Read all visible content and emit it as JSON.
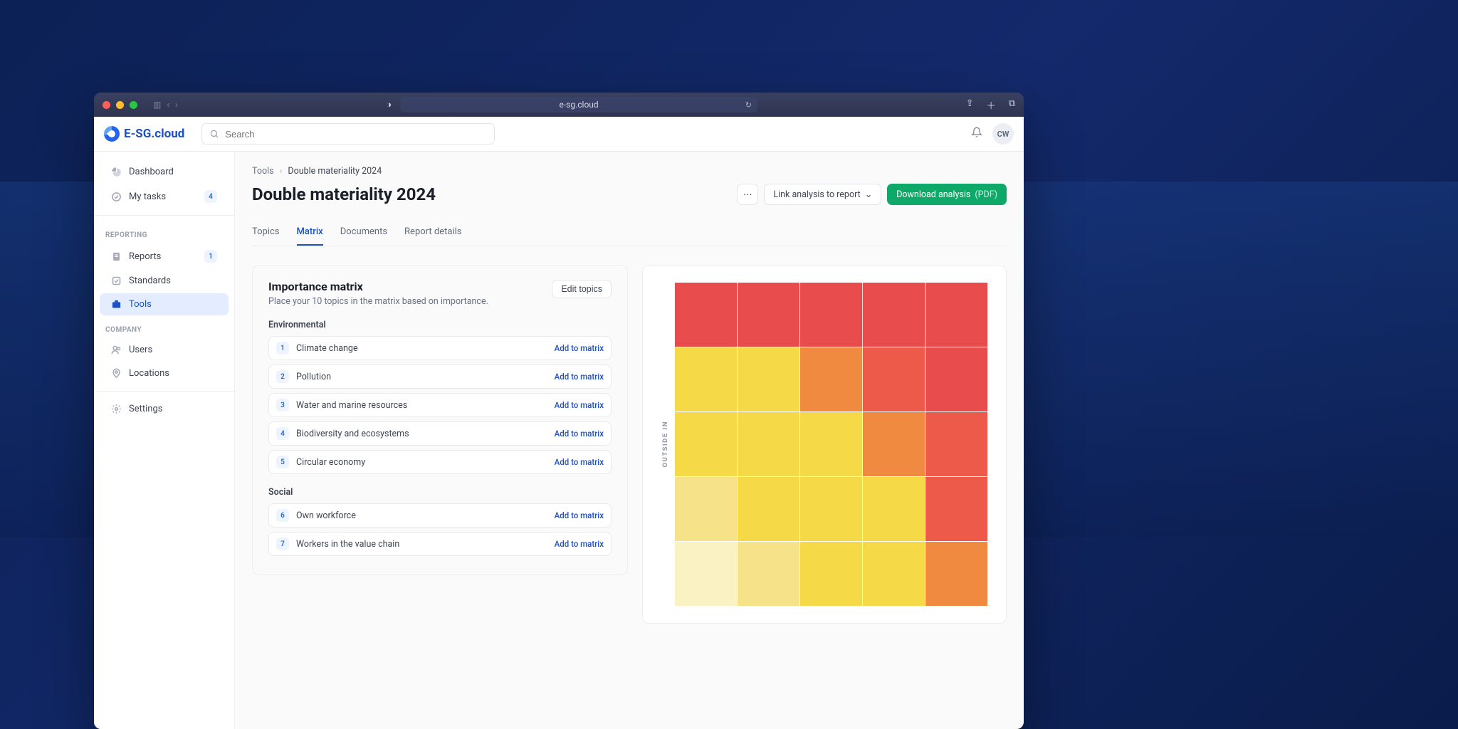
{
  "browser": {
    "url": "e-sg.cloud"
  },
  "app": {
    "logo_text": "E-SG.cloud",
    "search_placeholder": "Search",
    "avatar_initials": "CW"
  },
  "sidebar": {
    "items": [
      {
        "icon": "dashboard-icon",
        "label": "Dashboard"
      },
      {
        "icon": "check-icon",
        "label": "My tasks",
        "badge": "4"
      }
    ],
    "sections": [
      {
        "label": "REPORTING",
        "items": [
          {
            "icon": "report-icon",
            "label": "Reports",
            "badge": "1"
          },
          {
            "icon": "check-square-icon",
            "label": "Standards"
          },
          {
            "icon": "briefcase-icon",
            "label": "Tools",
            "active": true
          }
        ]
      },
      {
        "label": "COMPANY",
        "items": [
          {
            "icon": "users-icon",
            "label": "Users"
          },
          {
            "icon": "pin-icon",
            "label": "Locations"
          }
        ]
      }
    ],
    "footer": [
      {
        "icon": "gear-icon",
        "label": "Settings"
      }
    ]
  },
  "breadcrumb": {
    "root": "Tools",
    "current": "Double materiality 2024"
  },
  "page": {
    "title": "Double materiality 2024",
    "link_report_label": "Link analysis to report",
    "download_label": "Download analysis",
    "download_suffix": "(PDF)"
  },
  "tabs": [
    "Topics",
    "Matrix",
    "Documents",
    "Report details"
  ],
  "active_tab": "Matrix",
  "panel": {
    "title": "Importance matrix",
    "subtitle": "Place your 10 topics in the matrix based on importance.",
    "edit_label": "Edit topics",
    "add_label": "Add to matrix",
    "groups": [
      {
        "label": "Environmental",
        "topics": [
          {
            "num": "1",
            "name": "Climate change"
          },
          {
            "num": "2",
            "name": "Pollution"
          },
          {
            "num": "3",
            "name": "Water and marine resources"
          },
          {
            "num": "4",
            "name": "Biodiversity and ecosystems"
          },
          {
            "num": "5",
            "name": "Circular economy"
          }
        ]
      },
      {
        "label": "Social",
        "topics": [
          {
            "num": "6",
            "name": "Own workforce"
          },
          {
            "num": "7",
            "name": "Workers in the value chain"
          }
        ]
      }
    ]
  },
  "matrix": {
    "y_axis": "OUTSIDE IN",
    "cells": [
      "c-red",
      "c-red",
      "c-red",
      "c-red",
      "c-red",
      "c-yel",
      "c-yel",
      "c-orange",
      "c-red2",
      "c-red",
      "c-yel",
      "c-yel",
      "c-yel",
      "c-orange",
      "c-red2",
      "c-yel2",
      "c-yel",
      "c-yel",
      "c-yel",
      "c-red2",
      "c-yel3",
      "c-yel2",
      "c-yel",
      "c-yel",
      "c-orange"
    ]
  }
}
